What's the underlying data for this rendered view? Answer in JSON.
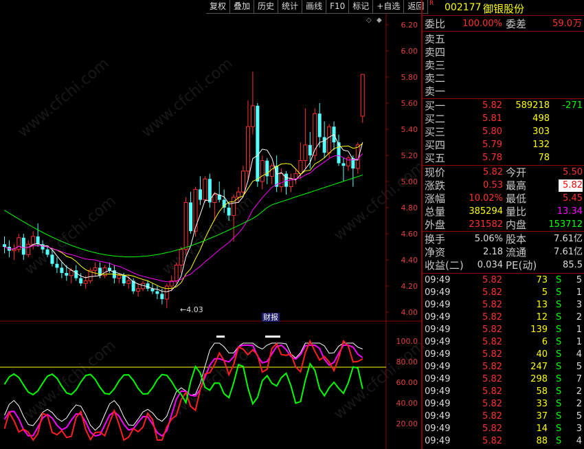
{
  "toolbar": [
    "复权",
    "叠加",
    "历史",
    "统计",
    "画线",
    "F10",
    "标记",
    "+自选",
    "返回"
  ],
  "stock": {
    "flag": "R",
    "code": "002177",
    "name": "御银股份"
  },
  "weibi": {
    "label": "委比",
    "value": "100.00%",
    "label2": "委差",
    "value2": "59.0",
    "unit": "万"
  },
  "sell": [
    {
      "label": "卖五"
    },
    {
      "label": "卖四"
    },
    {
      "label": "卖三"
    },
    {
      "label": "卖二"
    },
    {
      "label": "卖一"
    }
  ],
  "buy": [
    {
      "label": "买一",
      "price": "5.82",
      "vol": "589218",
      "chg": "-271"
    },
    {
      "label": "买二",
      "price": "5.81",
      "vol": "498",
      "chg": ""
    },
    {
      "label": "买三",
      "price": "5.80",
      "vol": "303",
      "chg": ""
    },
    {
      "label": "买四",
      "price": "5.79",
      "vol": "132",
      "chg": ""
    },
    {
      "label": "买五",
      "price": "5.78",
      "vol": "78",
      "chg": ""
    }
  ],
  "quote": [
    {
      "l1": "现价",
      "v1": "5.82",
      "l2": "今开",
      "v2": "5.50"
    },
    {
      "l1": "涨跌",
      "v1": "0.53",
      "l2": "最高",
      "v2": "5.82"
    },
    {
      "l1": "涨幅",
      "v1": "10.02%",
      "l2": "最低",
      "v2": "5.45"
    },
    {
      "l1": "总量",
      "v1": "385294",
      "l2": "量比",
      "v2": "13.34"
    },
    {
      "l1": "外盘",
      "v1": "231582",
      "l2": "内盘",
      "v2": "153712"
    }
  ],
  "fin": [
    {
      "l1": "换手",
      "v1": "5.06%",
      "l2": "股本",
      "v2": "7.61亿"
    },
    {
      "l1": "净资",
      "v1": "2.18",
      "l2": "流通",
      "v2": "7.61亿"
    },
    {
      "l1": "收益(二)",
      "v1": "0.034",
      "l2": "PE(动)",
      "v2": "85.5"
    }
  ],
  "ticks": [
    {
      "t": "09:49",
      "p": "5.82",
      "v": "73",
      "s": "S",
      "n": "5"
    },
    {
      "t": "09:49",
      "p": "5.82",
      "v": "5",
      "s": "S",
      "n": "1"
    },
    {
      "t": "09:49",
      "p": "5.82",
      "v": "13",
      "s": "S",
      "n": "3"
    },
    {
      "t": "09:49",
      "p": "5.82",
      "v": "12",
      "s": "S",
      "n": "2"
    },
    {
      "t": "09:49",
      "p": "5.82",
      "v": "139",
      "s": "S",
      "n": "1"
    },
    {
      "t": "09:49",
      "p": "5.82",
      "v": "6",
      "s": "S",
      "n": "1"
    },
    {
      "t": "09:49",
      "p": "5.82",
      "v": "40",
      "s": "S",
      "n": "4"
    },
    {
      "t": "09:49",
      "p": "5.82",
      "v": "247",
      "s": "S",
      "n": "5"
    },
    {
      "t": "09:49",
      "p": "5.82",
      "v": "298",
      "s": "S",
      "n": "7"
    },
    {
      "t": "09:49",
      "p": "5.82",
      "v": "58",
      "s": "S",
      "n": "2"
    },
    {
      "t": "09:49",
      "p": "5.82",
      "v": "33",
      "s": "S",
      "n": "2"
    },
    {
      "t": "09:49",
      "p": "5.82",
      "v": "37",
      "s": "S",
      "n": "5"
    },
    {
      "t": "09:49",
      "p": "5.82",
      "v": "14",
      "s": "S",
      "n": "3"
    },
    {
      "t": "09:49",
      "p": "5.82",
      "v": "88",
      "s": "S",
      "n": "4"
    }
  ],
  "price_axis": [
    "6.20",
    "6.00",
    "5.80",
    "5.60",
    "5.40",
    "5.20",
    "5.00",
    "4.80",
    "4.60",
    "4.40",
    "4.20",
    "4.00"
  ],
  "ind_axis": [
    "100.0",
    "80.00",
    "60.00",
    "40.00",
    "20.00"
  ],
  "annotations": {
    "low_label": "4.03",
    "mid_label": "财报"
  },
  "watermark": "www.cfchi.com",
  "colors": {
    "up": "#ff3232",
    "down": "#54ffff",
    "ma5": "#ffffff",
    "ma10": "#ffff00",
    "ma20": "#ff00ff",
    "ma60": "#00ff00",
    "border": "#8b0000",
    "yellow": "#ffff00"
  }
}
